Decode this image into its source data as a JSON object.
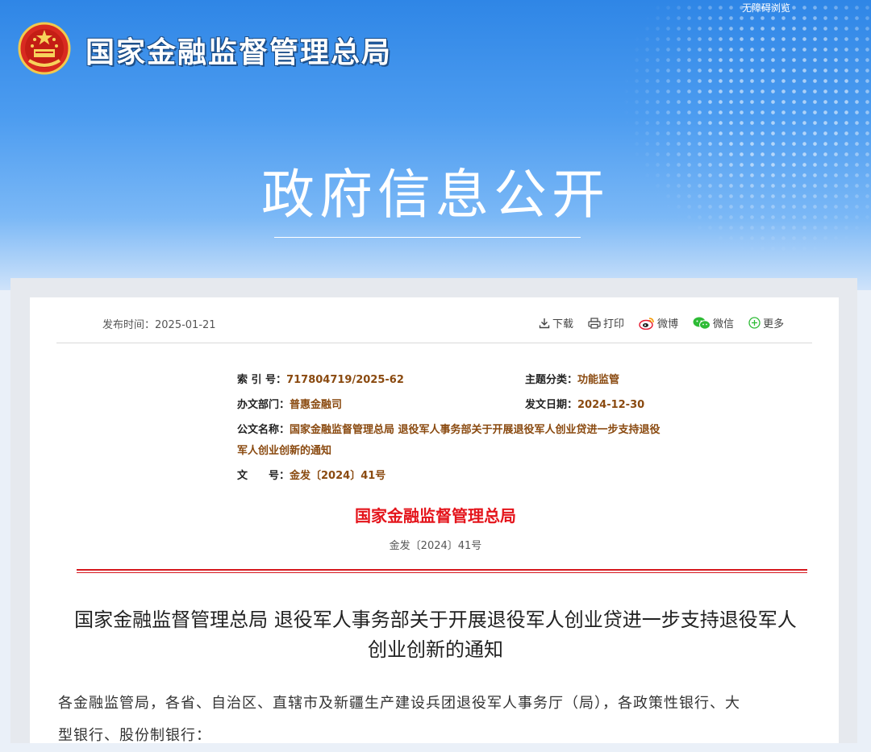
{
  "header": {
    "org_name": "国家金融监督管理总局",
    "accessibility": "无障碍浏览",
    "banner_title": "政府信息公开"
  },
  "toolbar": {
    "pubdate_label": "发布时间：",
    "pubdate_value": "2025-01-21",
    "download": "下载",
    "print": "打印",
    "weibo": "微博",
    "wechat": "微信",
    "more": "更多"
  },
  "meta": {
    "index_label": "索 引 号：",
    "index_value": "717804719/2025-62",
    "category_label": "主题分类：",
    "category_value": "功能监管",
    "dept_label": "办文部门：",
    "dept_value": "普惠金融司",
    "issue_date_label": "发文日期：",
    "issue_date_value": "2024-12-30",
    "name_label": "公文名称：",
    "name_value_line1": "国家金融监督管理总局 退役军人事务部关于开展退役军人创业贷进一步支持退役",
    "name_value_line2": "军人创业创新的通知",
    "docno_label": "文　　号：",
    "docno_value": "金发〔2024〕41号"
  },
  "document": {
    "issuer": "国家金融监督管理总局",
    "number": "金发〔2024〕41号",
    "title_line1": "国家金融监督管理总局 退役军人事务部关于开展退役军人创业贷进一步支持退役军人",
    "title_line2": "创业创新的通知",
    "salutation_line1": "各金融监管局，各省、自治区、直辖市及新疆生产建设兵团退役军人事务厅（局），各政策性银行、大",
    "salutation_line2": "型银行、股份制银行："
  },
  "colors": {
    "banner": "#2f86e6",
    "doc_red": "#e4141b",
    "meta_value": "#8a4a10"
  }
}
